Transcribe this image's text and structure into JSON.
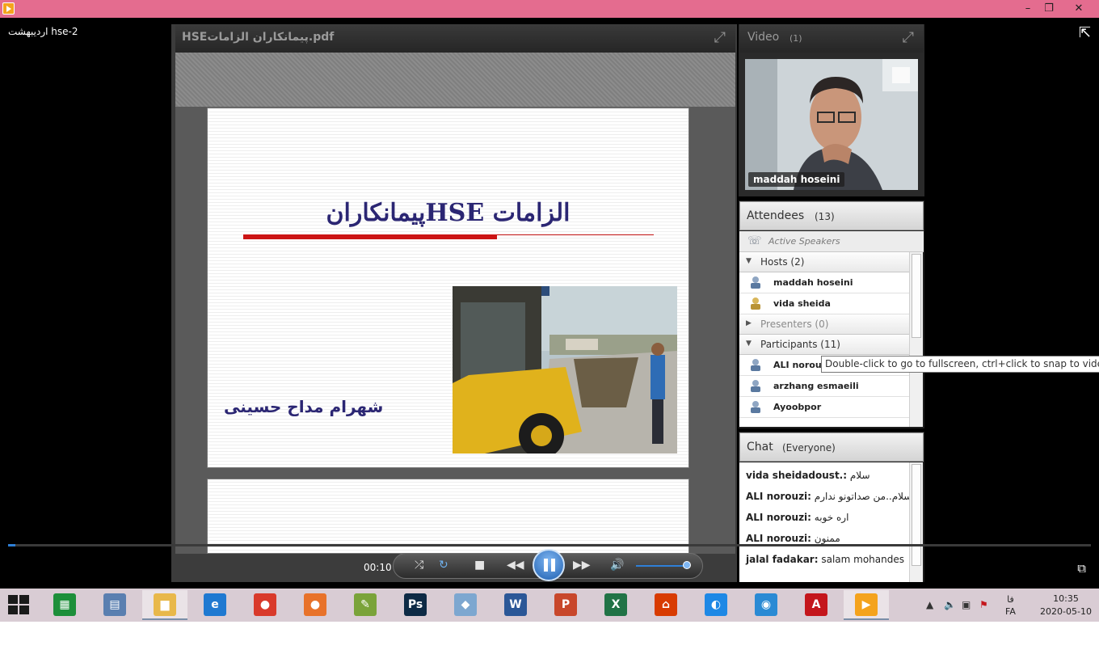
{
  "window": {
    "minimize": "–",
    "restore": "❐",
    "close": "✕"
  },
  "recording": {
    "title": "hse-2 اردیبهشت"
  },
  "document": {
    "filename": "HSEپیمانکاران الزامات.pdf",
    "slide_title": "الزامات HSEپیمانکاران",
    "slide_author": "شهرام مداح حسینی"
  },
  "video": {
    "label": "Video",
    "count": "(1)",
    "speaker_name": "maddah hoseini"
  },
  "attendees": {
    "label": "Attendees",
    "count": "(13)",
    "active_speakers": "Active Speakers",
    "groups": {
      "hosts": "Hosts (2)",
      "presenters": "Presenters (0)",
      "participants": "Participants (11)"
    },
    "hosts": [
      "maddah hoseini",
      "vida sheida"
    ],
    "participants": [
      "ALI norou",
      "arzhang esmaeili",
      "Ayoobpor"
    ]
  },
  "chat": {
    "label": "Chat",
    "audience": "(Everyone)",
    "messages": [
      {
        "sender": "vida sheidadoust.:",
        "text": "سلام"
      },
      {
        "sender": "ALI norouzi:",
        "text": "سلام..من صداتونو ندارم"
      },
      {
        "sender": "ALI norouzi:",
        "text": "اره خوبه"
      },
      {
        "sender": "ALI norouzi:",
        "text": "ممنون"
      },
      {
        "sender": "jalal fadakar:",
        "text": "salam mohandes"
      }
    ]
  },
  "tooltip": {
    "text": "Double-click to go to fullscreen, ctrl+click to snap to video size"
  },
  "playback": {
    "time": "00:10",
    "progress_percent": 0.7,
    "volume_percent": 90,
    "state": "playing"
  },
  "taskbar": {
    "apps": [
      {
        "name": "calculator",
        "glyph": "▦",
        "color": "#1d8f3a"
      },
      {
        "name": "remote-desktop",
        "glyph": "▤",
        "color": "#5a7fb0"
      },
      {
        "name": "file-explorer",
        "glyph": "▆",
        "color": "#e8b84a"
      },
      {
        "name": "internet-explorer",
        "glyph": "e",
        "color": "#1f79d1"
      },
      {
        "name": "chrome",
        "glyph": "●",
        "color": "#d93a2b"
      },
      {
        "name": "firefox",
        "glyph": "●",
        "color": "#e8722a"
      },
      {
        "name": "notepad-plus",
        "glyph": "✎",
        "color": "#7aa33a"
      },
      {
        "name": "photoshop",
        "glyph": "Ps",
        "color": "#0d2a45"
      },
      {
        "name": "virtualbox",
        "glyph": "◆",
        "color": "#7da7d0"
      },
      {
        "name": "word",
        "glyph": "W",
        "color": "#2b5797"
      },
      {
        "name": "powerpoint",
        "glyph": "P",
        "color": "#c8472b"
      },
      {
        "name": "excel",
        "glyph": "X",
        "color": "#217346"
      },
      {
        "name": "office",
        "glyph": "⌂",
        "color": "#d83b01"
      },
      {
        "name": "edge-like",
        "glyph": "◐",
        "color": "#1e88e5"
      },
      {
        "name": "network-browser",
        "glyph": "◉",
        "color": "#2a8ad4"
      },
      {
        "name": "acrobat",
        "glyph": "A",
        "color": "#c4161c"
      },
      {
        "name": "media-player",
        "glyph": "▶",
        "color": "#f4a31d"
      }
    ],
    "language_top": "فا",
    "language_bottom": "FA",
    "time": "10:35",
    "date": "2020-05-10"
  }
}
